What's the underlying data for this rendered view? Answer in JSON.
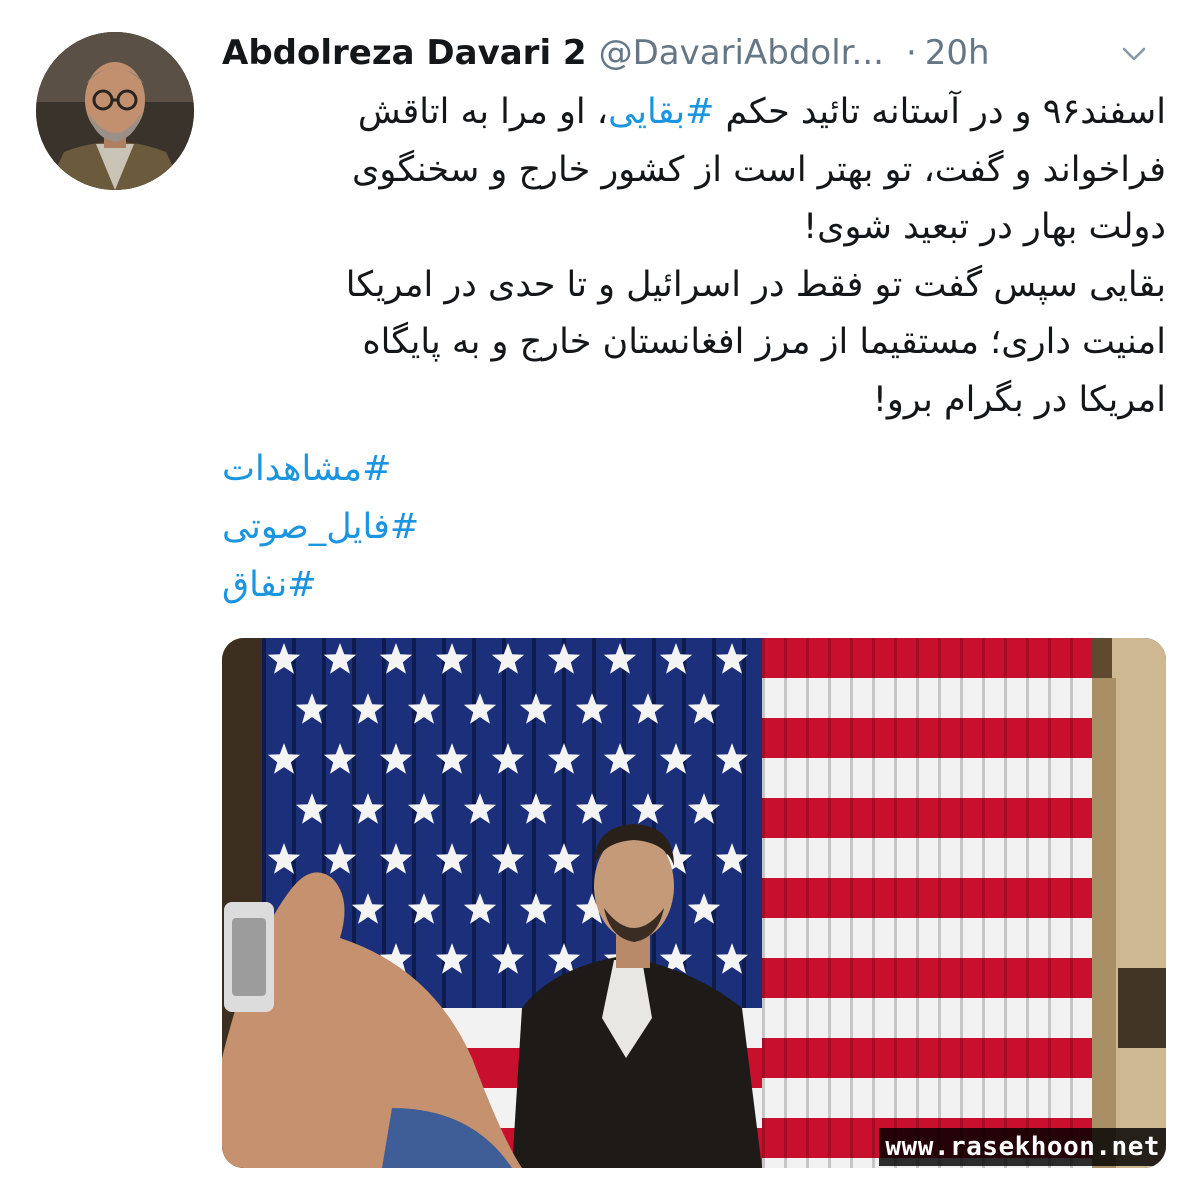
{
  "tweet": {
    "author_name": "Abdolreza Davari 2",
    "handle": "@DavariAbdolr...",
    "separator": "·",
    "timestamp": "20h",
    "menu_icon": "chevron-down-icon",
    "text": {
      "line1_before": "اسفند۹۶ و در آستانه تائید حکم ",
      "line1_tag": "#بقایی",
      "line1_after": "، او مرا به اتاقش",
      "line2": "فراخواند و گفت، تو بهتر است از کشور خارج و سخنگوی",
      "line3": "دولت بهار در تبعید شوی!",
      "line4": "بقایی سپس گفت تو فقط در اسرائیل و تا حدی در امریکا",
      "line5": "امنیت داری؛ مستقیما از مرز افغانستان خارج و به پایگاه",
      "line6": "امریکا در بگرام برو!"
    },
    "hashtags": [
      "#مشاهدات",
      "#فایل_صوتی",
      "#نفاق"
    ],
    "media": {
      "watermark": "www.rasekhoon.net"
    }
  },
  "colors": {
    "link": "#1b95e0",
    "meta": "#657786",
    "text": "#14171a",
    "flag_red": "#c8102e",
    "flag_blue": "#1b2f7a"
  }
}
